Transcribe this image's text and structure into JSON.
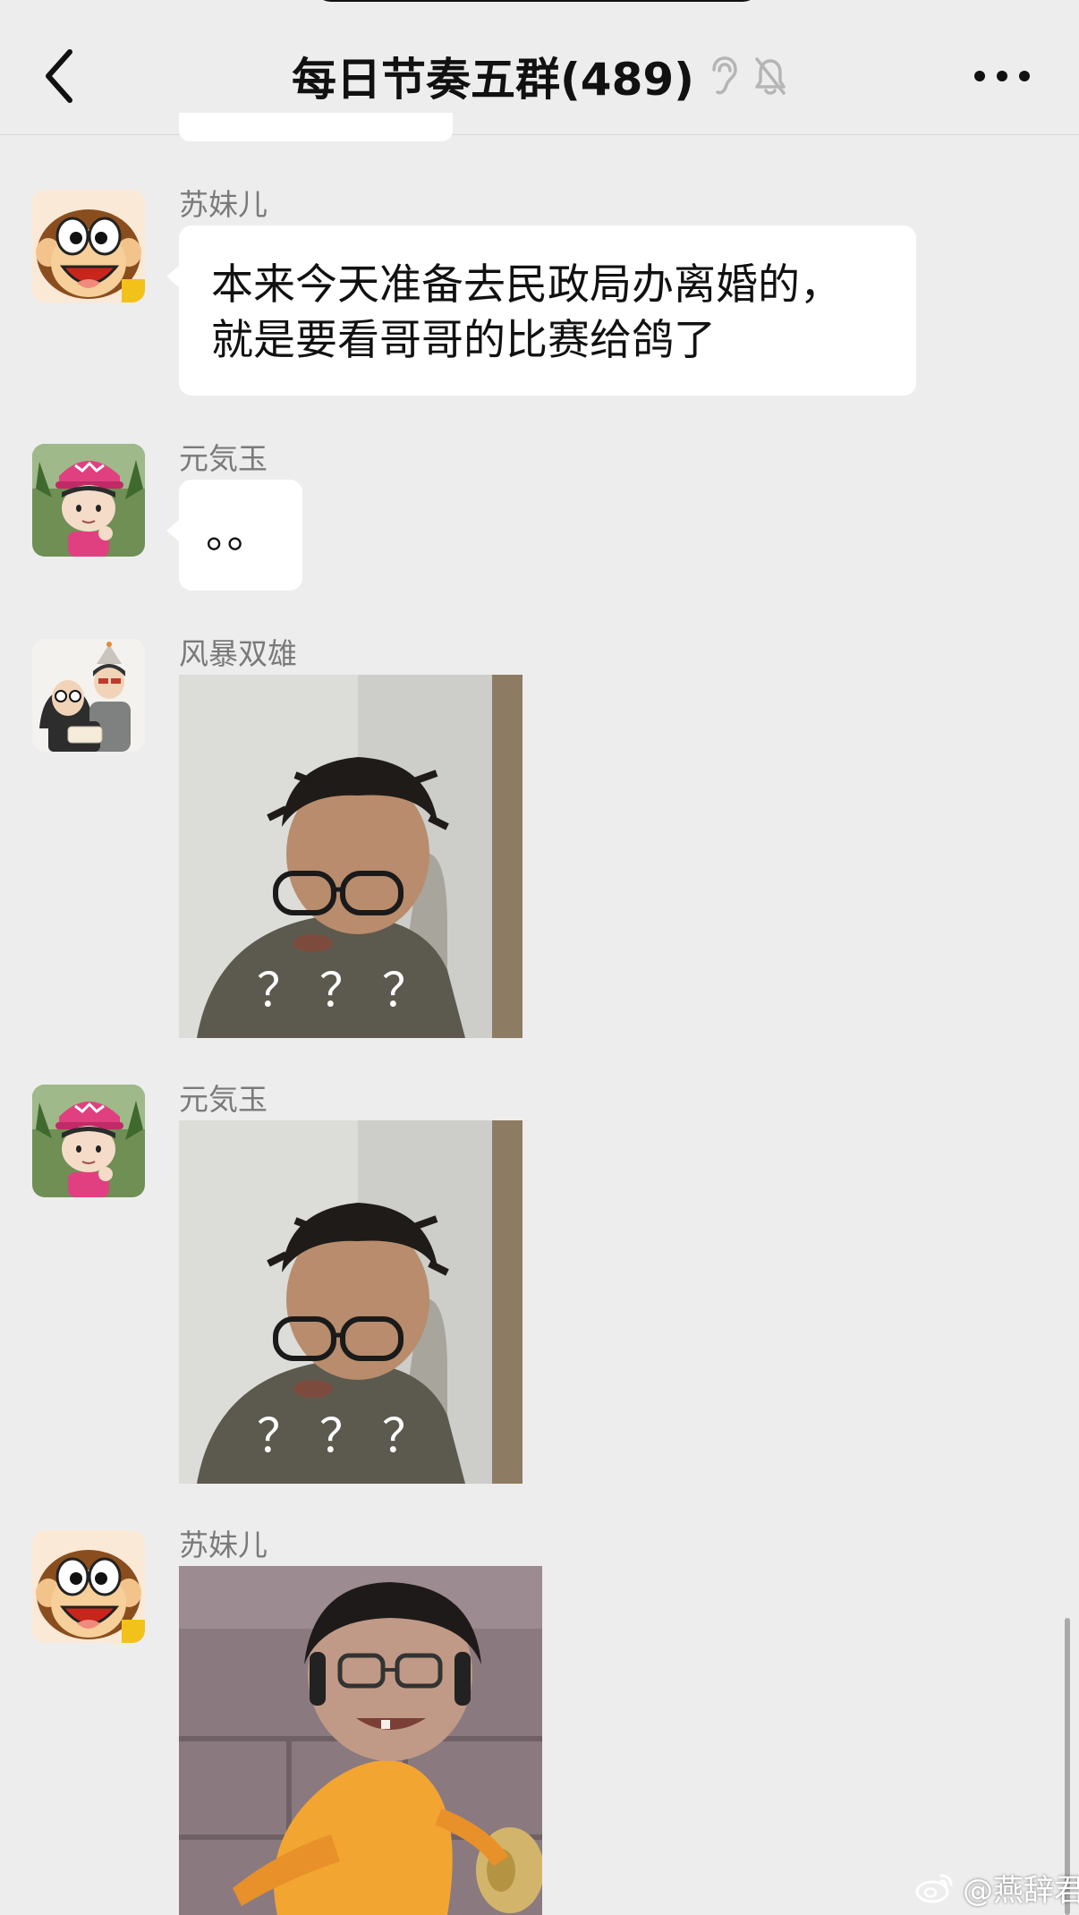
{
  "header": {
    "title": "每日节奏五群(489)",
    "back_icon": "chevron-left-icon",
    "ear_icon": "ear-icon",
    "mute_icon": "bell-off-icon",
    "more_icon": "more-horizontal-icon"
  },
  "messages": [
    {
      "sender": "苏妹儿",
      "type": "text",
      "lines": [
        "本来今天准备去民政局办离婚的，",
        "就是要看哥哥的比赛给鸽了"
      ]
    },
    {
      "sender": "元気玉",
      "type": "text",
      "lines": [
        "。。"
      ]
    },
    {
      "sender": "风暴双雄",
      "type": "sticker",
      "caption": "？？？"
    },
    {
      "sender": "元気玉",
      "type": "sticker",
      "caption": "？？？"
    },
    {
      "sender": "苏妹儿",
      "type": "sticker",
      "caption": ""
    }
  ],
  "watermark": {
    "text": "@燕辞君",
    "icon": "weibo-icon"
  },
  "colors": {
    "background": "#ededed",
    "bubble": "#ffffff",
    "sender_text": "#7a7a7a"
  }
}
